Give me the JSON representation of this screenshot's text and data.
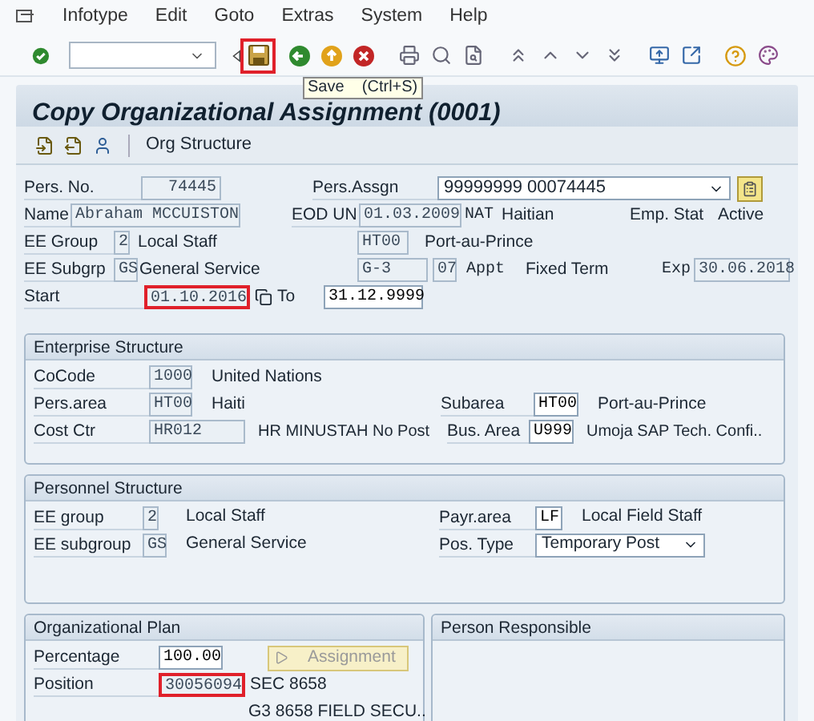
{
  "menu": [
    {
      "label": "Infotype"
    },
    {
      "label": "Edit"
    },
    {
      "label": "Goto"
    },
    {
      "label": "Extras"
    },
    {
      "label": "System"
    },
    {
      "label": "Help"
    }
  ],
  "toolbar": {
    "save_highlighted": true,
    "tooltip": "Save    (Ctrl+S)"
  },
  "title": "Copy Organizational Assignment (0001)",
  "app_toolbar": {
    "button": "Org Structure"
  },
  "header": {
    "pers_no": {
      "label": "Pers. No.",
      "value": "74445"
    },
    "pers_assgn": {
      "label": "Pers.Assgn",
      "value": "99999999 00074445"
    },
    "name": {
      "label": "Name",
      "value": "Abraham MCCUISTON"
    },
    "eod": {
      "label": "EOD UN",
      "value": "01.03.2009"
    },
    "nationality": {
      "label": "NAT",
      "value": "Haitian"
    },
    "emp_stat": {
      "label": "Emp. Stat",
      "value": "Active"
    },
    "ee_group": {
      "label": "EE Group",
      "code": "2",
      "text": "Local Staff"
    },
    "location": {
      "code": "HT00",
      "text": "Port-au-Prince"
    },
    "ee_subgrp": {
      "label": "EE Subgrp",
      "code": "GS",
      "text": "General Service"
    },
    "grade": {
      "code": "G-3",
      "step": "07"
    },
    "appt": {
      "label": "Appt",
      "value": "Fixed Term"
    },
    "exp": {
      "label": "Exp",
      "value": "30.06.2018"
    },
    "start": {
      "label": "Start",
      "value": "01.10.2016",
      "highlighted": true
    },
    "to": {
      "label": "To",
      "value": "31.12.9999"
    }
  },
  "enterprise": {
    "title": "Enterprise Structure",
    "cocode": {
      "label": "CoCode",
      "code": "1000",
      "text": "United Nations"
    },
    "pers_area": {
      "label": "Pers.area",
      "code": "HT00",
      "text": "Haiti"
    },
    "subarea": {
      "label": "Subarea",
      "code": "HT00",
      "text": "Port-au-Prince"
    },
    "cost_ctr": {
      "label": "Cost Ctr",
      "code": "HR012",
      "text": "HR MINUSTAH No Post"
    },
    "bus_area": {
      "label": "Bus. Area",
      "code": "U999",
      "text": "Umoja SAP Tech. Confi.."
    }
  },
  "personnel": {
    "title": "Personnel Structure",
    "ee_group": {
      "label": "EE group",
      "code": "2",
      "text": "Local Staff"
    },
    "ee_subgroup": {
      "label": "EE subgroup",
      "code": "GS",
      "text": "General Service"
    },
    "payr_area": {
      "label": "Payr.area",
      "code": "LF",
      "text": "Local Field Staff"
    },
    "pos_type": {
      "label": "Pos. Type",
      "value": "Temporary Post"
    }
  },
  "org_plan": {
    "title": "Organizational Plan",
    "percentage": {
      "label": "Percentage",
      "value": "100.00"
    },
    "assignment_button": "Assignment",
    "position": {
      "label": "Position",
      "value": "30056094",
      "text": "SEC 8658",
      "highlighted": true
    },
    "position_long": "G3 8658 FIELD SECU.."
  },
  "person_responsible": {
    "title": "Person Responsible"
  }
}
